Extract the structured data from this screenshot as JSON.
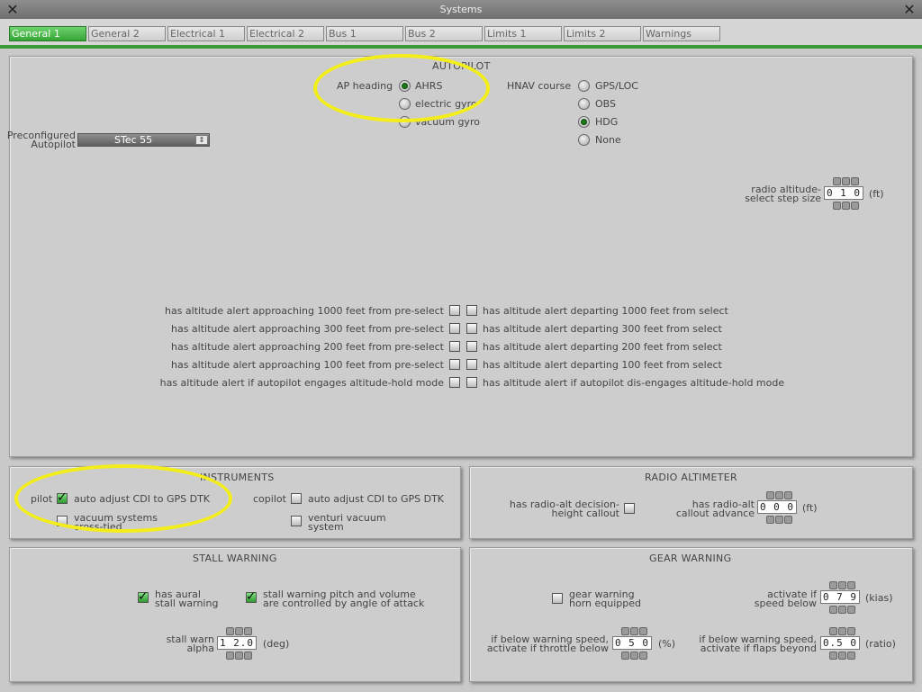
{
  "window": {
    "title": "Systems"
  },
  "tabs": [
    "General 1",
    "General 2",
    "Electrical 1",
    "Electrical 2",
    "Bus 1",
    "Bus 2",
    "Limits 1",
    "Limits 2",
    "Warnings"
  ],
  "autopilot": {
    "title": "AUTOPILOT",
    "ap_heading_label": "AP heading",
    "ap_heading_options": [
      "AHRS",
      "electric gyro",
      "vacuum gyro"
    ],
    "ap_heading_selected": "AHRS",
    "hnav_label": "HNAV course",
    "hnav_options": [
      "GPS/LOC",
      "OBS",
      "HDG",
      "None"
    ],
    "hnav_selected": "HDG",
    "preconfig_label_1": "Preconfigured",
    "preconfig_label_2": "Autopilot",
    "preconfig_value": "STec 55",
    "step_label_1": "radio altitude-",
    "step_label_2": "select step size",
    "step_value": "0 1 0",
    "step_unit": "(ft)",
    "alerts_left": [
      "has altitude alert approaching 1000 feet from pre-select",
      "has altitude alert approaching 300 feet from pre-select",
      "has altitude alert approaching 200 feet from pre-select",
      "has altitude alert approaching 100 feet from pre-select",
      "has altitude alert if autopilot engages altitude-hold mode"
    ],
    "alerts_right": [
      "has altitude alert departing 1000 feet from select",
      "has altitude alert departing 300 feet from select",
      "has altitude alert departing 200 feet from select",
      "has altitude alert departing 100 feet from select",
      "has altitude alert if autopilot dis-engages altitude-hold mode"
    ]
  },
  "instruments": {
    "title": "INSTRUMENTS",
    "pilot_label": "pilot",
    "copilot_label": "copilot",
    "auto_adjust_label": "auto adjust CDI to GPS DTK",
    "vacuum_label_1": "vacuum systems",
    "vacuum_label_2": "cross-tied",
    "venturi_label_1": "venturi vacuum",
    "venturi_label_2": "system",
    "pilot_auto_adjust": true,
    "copilot_auto_adjust": false,
    "vacuum_cross_tied": false,
    "venturi_vacuum": false
  },
  "radio_altimeter": {
    "title": "RADIO ALTIMETER",
    "decision_label_1": "has radio-alt decision-",
    "decision_label_2": "height callout",
    "callout_label_1": "has radio-alt",
    "callout_label_2": "callout advance",
    "callout_value": "0 0 0",
    "callout_unit": "(ft)"
  },
  "stall_warning": {
    "title": "STALL WARNING",
    "aural_label_1": "has aural",
    "aural_label_2": "stall warning",
    "pitch_label_1": "stall warning pitch and volume",
    "pitch_label_2": "are controlled by angle of attack",
    "alpha_label_1": "stall warn",
    "alpha_label_2": "alpha",
    "alpha_value": "1 2.0",
    "alpha_unit": "(deg)"
  },
  "gear_warning": {
    "title": "GEAR WARNING",
    "horn_label_1": "gear warning",
    "horn_label_2": "horn equipped",
    "activate_label_1": "activate if",
    "activate_label_2": "speed below",
    "activate_value": "0 7 9",
    "activate_unit": "(kias)",
    "throttle_label_1": "if below warning speed,",
    "throttle_label_2": "activate if throttle below",
    "throttle_value": "0 5 0",
    "throttle_unit": "(%)",
    "flaps_label_1": "if below warning speed,",
    "flaps_label_2": "activate if flaps beyond",
    "flaps_value": "0.5 0",
    "flaps_unit": "(ratio)"
  },
  "colors": {
    "active_tab": "#3aa83a",
    "highlight": "#f3ee1a",
    "radio_on": "#1b7a1b"
  }
}
